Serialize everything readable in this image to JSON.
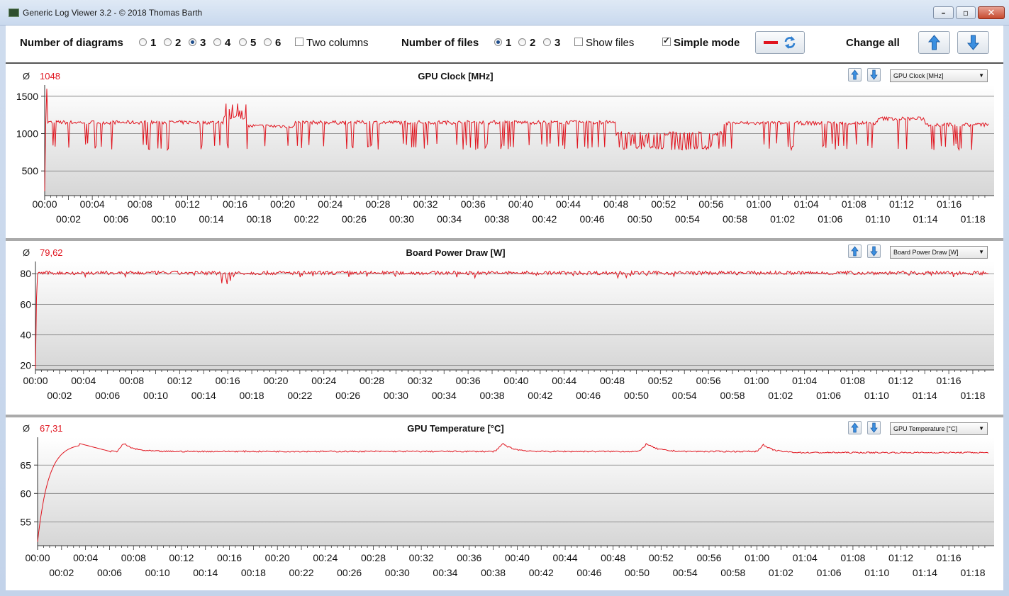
{
  "window": {
    "title": "Generic Log Viewer 3.2 - © 2018 Thomas Barth"
  },
  "toolbar": {
    "num_diagrams_label": "Number of diagrams",
    "diagram_options": [
      "1",
      "2",
      "3",
      "4",
      "5",
      "6"
    ],
    "diagram_selected": "3",
    "two_columns_label": "Two columns",
    "two_columns_checked": false,
    "num_files_label": "Number of files",
    "file_options": [
      "1",
      "2",
      "3"
    ],
    "file_selected": "1",
    "show_files_label": "Show files",
    "show_files_checked": false,
    "simple_mode_label": "Simple mode",
    "simple_mode_checked": true,
    "change_all_label": "Change all",
    "line_color": "#e0141e",
    "icons": [
      "red-line-icon",
      "refresh-icon",
      "arrow-up-icon",
      "arrow-down-icon"
    ]
  },
  "panels": [
    {
      "avg_symbol": "Ø",
      "avg_value": "1048",
      "title": "GPU Clock [MHz]",
      "select_value": "GPU Clock [MHz]"
    },
    {
      "avg_symbol": "Ø",
      "avg_value": "79,62",
      "title": "Board Power Draw [W]",
      "select_value": "Board Power Draw [W]"
    },
    {
      "avg_symbol": "Ø",
      "avg_value": "67,31",
      "title": "GPU Temperature [°C]",
      "select_value": "GPU Temperature [°C]"
    }
  ],
  "chart_data": [
    {
      "type": "line",
      "title": "GPU Clock [MHz]",
      "x_ticks_top": [
        "00:00",
        "00:04",
        "00:08",
        "00:12",
        "00:16",
        "00:20",
        "00:24",
        "00:28",
        "00:32",
        "00:36",
        "00:40",
        "00:44",
        "00:48",
        "00:52",
        "00:56",
        "01:00",
        "01:04",
        "01:08",
        "01:12",
        "01:16"
      ],
      "x_ticks_bottom": [
        "00:02",
        "00:06",
        "00:10",
        "00:14",
        "00:18",
        "00:22",
        "00:26",
        "00:30",
        "00:34",
        "00:38",
        "00:42",
        "00:46",
        "00:50",
        "00:54",
        "00:58",
        "01:02",
        "01:06",
        "01:10",
        "01:14",
        "01:18"
      ],
      "xlim_minutes": [
        0,
        79.3
      ],
      "yticks": [
        500,
        1000,
        1500
      ],
      "ylim": [
        170,
        1650
      ],
      "grid": true,
      "series": [
        {
          "color": "#e0141e",
          "baseline": 1150,
          "dip_low": 780,
          "dip_freq": 0.13,
          "noise": 25,
          "start": 230,
          "peak": 1600,
          "segments": [
            [
              0,
              15,
              1150
            ],
            [
              15,
              17,
              1220
            ],
            [
              17,
              21,
              1100
            ],
            [
              21,
              30,
              1150
            ],
            [
              30,
              40,
              1150
            ],
            [
              40,
              48,
              1150
            ],
            [
              48,
              57,
              1000
            ],
            [
              57,
              70,
              1140
            ],
            [
              70,
              74,
              1200
            ],
            [
              74,
              79.3,
              1120
            ]
          ]
        }
      ]
    },
    {
      "type": "line",
      "title": "Board Power Draw [W]",
      "x_ticks_top": [
        "00:00",
        "00:04",
        "00:08",
        "00:12",
        "00:16",
        "00:20",
        "00:24",
        "00:28",
        "00:32",
        "00:36",
        "00:40",
        "00:44",
        "00:48",
        "00:52",
        "00:56",
        "01:00",
        "01:04",
        "01:08",
        "01:12",
        "01:16"
      ],
      "x_ticks_bottom": [
        "00:02",
        "00:06",
        "00:10",
        "00:14",
        "00:18",
        "00:22",
        "00:26",
        "00:30",
        "00:34",
        "00:38",
        "00:42",
        "00:46",
        "00:50",
        "00:54",
        "00:58",
        "01:02",
        "01:06",
        "01:10",
        "01:14",
        "01:18"
      ],
      "xlim_minutes": [
        0,
        79.3
      ],
      "yticks": [
        20,
        40,
        60,
        80
      ],
      "ylim": [
        17,
        88
      ],
      "grid": true,
      "series": [
        {
          "color": "#e0141e",
          "baseline": 80.5,
          "noise": 1.2,
          "start": 18
        }
      ]
    },
    {
      "type": "line",
      "title": "GPU Temperature [°C]",
      "x_ticks_top": [
        "00:00",
        "00:04",
        "00:08",
        "00:12",
        "00:16",
        "00:20",
        "00:24",
        "00:28",
        "00:32",
        "00:36",
        "00:40",
        "00:44",
        "00:48",
        "00:52",
        "00:56",
        "01:00",
        "01:04",
        "01:08",
        "01:12",
        "01:16"
      ],
      "x_ticks_bottom": [
        "00:02",
        "00:06",
        "00:10",
        "00:14",
        "00:18",
        "00:22",
        "00:26",
        "00:30",
        "00:34",
        "00:38",
        "00:42",
        "00:46",
        "00:50",
        "00:54",
        "00:58",
        "01:02",
        "01:06",
        "01:10",
        "01:14",
        "01:18"
      ],
      "xlim_minutes": [
        0,
        79.3
      ],
      "yticks": [
        55,
        60,
        65
      ],
      "ylim": [
        50.8,
        69.9
      ],
      "grid": true,
      "series": [
        {
          "color": "#e0141e",
          "baseline": 67.4,
          "start": 51.5,
          "peak_start": 68.8,
          "bumps_minutes": [
            7.2,
            38.8,
            50.8,
            60.5
          ],
          "bump_height": 1.4
        }
      ]
    }
  ]
}
